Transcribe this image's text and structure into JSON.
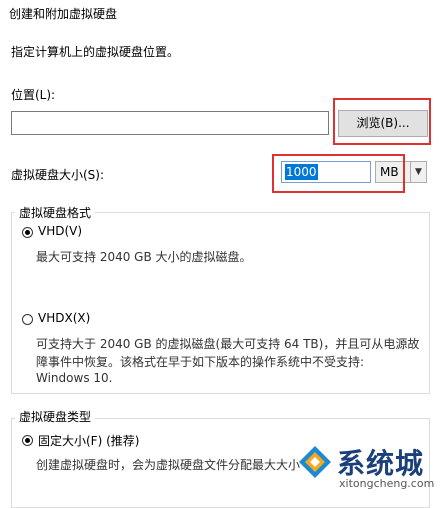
{
  "window": {
    "title": "创建和附加虚拟硬盘"
  },
  "description": "指定计算机上的虚拟硬盘位置。",
  "location": {
    "label": "位置(L):",
    "value": "",
    "browse_label": "浏览(B)..."
  },
  "size": {
    "label": "虚拟硬盘大小(S):",
    "value": "1000",
    "unit": "MB"
  },
  "format_group": {
    "title": "虚拟硬盘格式",
    "options": [
      {
        "label": "VHD(V)",
        "selected": true,
        "desc": [
          "最大可支持 2040 GB 大小的虚拟磁盘。"
        ]
      },
      {
        "label": "VHDX(X)",
        "selected": false,
        "desc": [
          "可支持大于 2040 GB 的虚拟磁盘(最大可支持 64 TB)，并且可从电源故",
          "障事件中恢复。该格式在早于如下版本的操作系统中不受支持:",
          "Windows 10."
        ]
      }
    ]
  },
  "type_group": {
    "title": "虚拟硬盘类型",
    "options": [
      {
        "label": "固定大小(F) (推荐)",
        "selected": true,
        "desc": [
          "创建虚拟硬盘时，会为虚拟硬盘文件分配最大大小"
        ]
      }
    ]
  },
  "watermark": {
    "brand": "系统城",
    "domain": "xitongcheng.com"
  },
  "colors": {
    "highlight_box": "#e03131",
    "selection": "#0078d7"
  }
}
